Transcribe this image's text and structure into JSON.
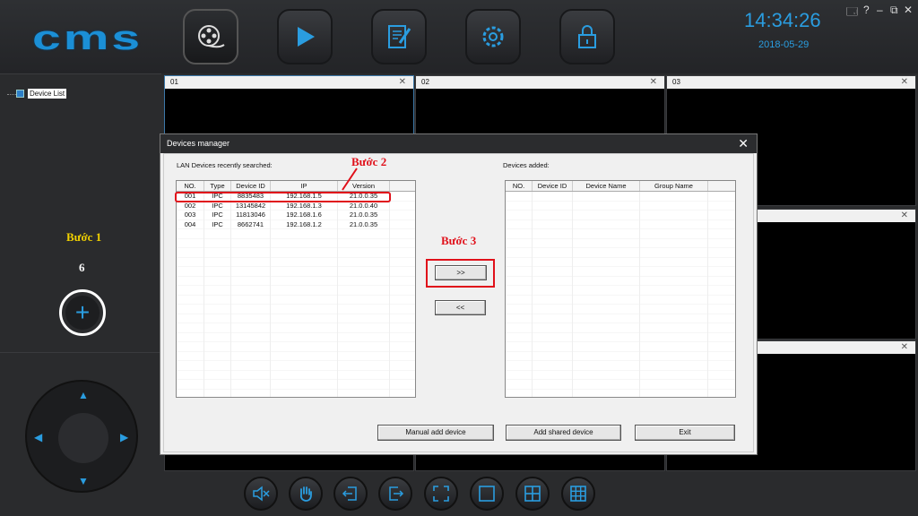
{
  "app": {
    "logo": "cms",
    "clock": "14:34:26",
    "date": "2018-05-29",
    "window_controls": [
      "🗔",
      "?",
      "–",
      "⧉",
      "✕"
    ]
  },
  "nav": [
    {
      "name": "video-reel-icon",
      "active": true
    },
    {
      "name": "play-icon",
      "active": false
    },
    {
      "name": "edit-document-icon",
      "active": false
    },
    {
      "name": "gear-icon",
      "active": false
    },
    {
      "name": "lock-icon",
      "active": false
    }
  ],
  "left": {
    "device_list_label": "Device List",
    "step1": "Bước 1",
    "count": "6",
    "add_symbol": "+"
  },
  "cells": [
    {
      "label": "01"
    },
    {
      "label": "02"
    },
    {
      "label": "03"
    }
  ],
  "dialog": {
    "title": "Devices manager",
    "close": "✕",
    "lan_label": "LAN Devices recently searched:",
    "added_label": "Devices added:",
    "lan_columns": [
      "NO.",
      "Type",
      "Device ID",
      "IP",
      "Version"
    ],
    "lan_rows": [
      [
        "001",
        "IPC",
        "8835483",
        "192.168.1.5",
        "21.0.0.35"
      ],
      [
        "002",
        "IPC",
        "13145842",
        "192.168.1.3",
        "21.0.0.40"
      ],
      [
        "003",
        "IPC",
        "11813046",
        "192.168.1.6",
        "21.0.0.35"
      ],
      [
        "004",
        "IPC",
        "8662741",
        "192.168.1.2",
        "21.0.0.35"
      ]
    ],
    "added_columns": [
      "NO.",
      "Device ID",
      "Device Name",
      "Group Name"
    ],
    "move_right": ">>",
    "move_left": "<<",
    "manual_add": "Manual add device",
    "add_shared": "Add shared device",
    "exit": "Exit",
    "step2": "Bước 2",
    "step3": "Bước 3"
  },
  "bottom_icons": [
    "mute-icon",
    "hand-icon",
    "import-icon",
    "export-icon",
    "fullscreen-icon",
    "single-view-icon",
    "quad-view-icon",
    "nine-view-icon"
  ],
  "colors": {
    "accent": "#2a9de0",
    "annotation_red": "#e0101a",
    "annotation_yellow": "#f0d000"
  }
}
